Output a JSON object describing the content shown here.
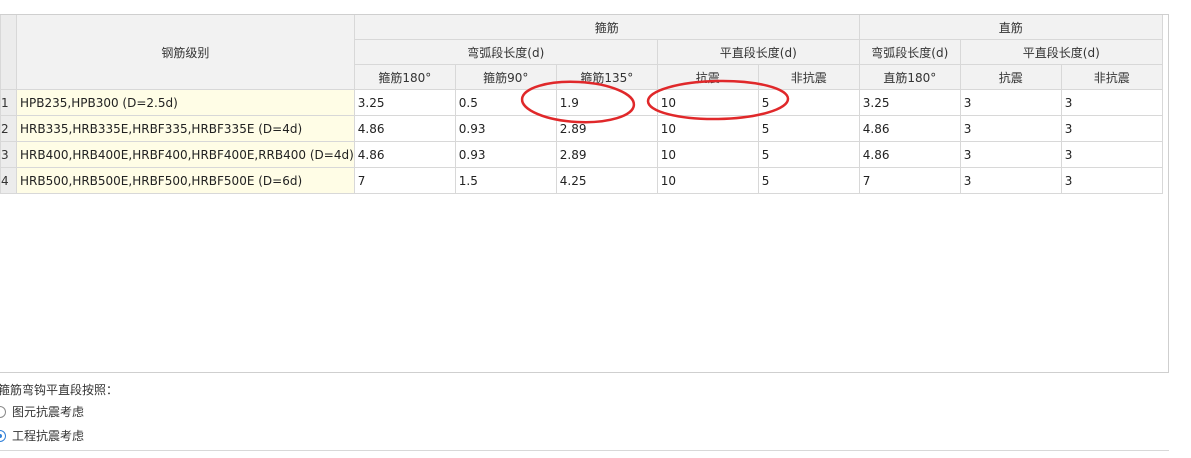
{
  "table": {
    "headers": {
      "grade": "钢筋级别",
      "stirrup_group": "箍筋",
      "straight_group": "直筋",
      "hook_arc_length": "弯弧段长度(d)",
      "flat_length": "平直段长度(d)",
      "straight_arc_length": "弯弧段长度(d)",
      "straight_flat_length": "平直段长度(d)",
      "stirrup_180": "箍筋180°",
      "stirrup_90": "箍筋90°",
      "stirrup_135": "箍筋135°",
      "seismic": "抗震",
      "non_seismic": "非抗震",
      "straight_180": "直筋180°",
      "straight_seismic": "抗震",
      "straight_non_seismic": "非抗震"
    },
    "rows": [
      {
        "num": "1",
        "grade": "HPB235,HPB300 (D=2.5d)",
        "s180": "3.25",
        "s90": "0.5",
        "s135": "1.9",
        "seismic": "10",
        "non_seismic": "5",
        "st180": "3.25",
        "st_seismic": "3",
        "st_non_seismic": "3"
      },
      {
        "num": "2",
        "grade": "HRB335,HRB335E,HRBF335,HRBF335E (D=4d)",
        "s180": "4.86",
        "s90": "0.93",
        "s135": "2.89",
        "seismic": "10",
        "non_seismic": "5",
        "st180": "4.86",
        "st_seismic": "3",
        "st_non_seismic": "3"
      },
      {
        "num": "3",
        "grade": "HRB400,HRB400E,HRBF400,HRBF400E,RRB400 (D=4d)",
        "s180": "4.86",
        "s90": "0.93",
        "s135": "2.89",
        "seismic": "10",
        "non_seismic": "5",
        "st180": "4.86",
        "st_seismic": "3",
        "st_non_seismic": "3"
      },
      {
        "num": "4",
        "grade": "HRB500,HRB500E,HRBF500,HRBF500E (D=6d)",
        "s180": "7",
        "s90": "1.5",
        "s135": "4.25",
        "seismic": "10",
        "non_seismic": "5",
        "st180": "7",
        "st_seismic": "3",
        "st_non_seismic": "3"
      }
    ]
  },
  "options": {
    "label": "箍筋弯钩平直段按照：",
    "choices": [
      {
        "label": "图元抗震考虑",
        "checked": false
      },
      {
        "label": "工程抗震考虑",
        "checked": true
      }
    ]
  },
  "annotation_color": "#e0282a",
  "radio_accent": "#2f7fd8"
}
